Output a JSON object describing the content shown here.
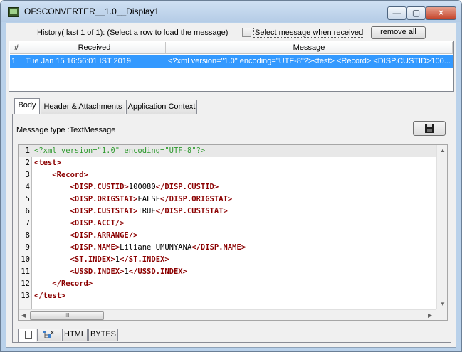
{
  "window": {
    "title": "OFSCONVERTER__1.0__Display1",
    "minimize_glyph": "—",
    "maximize_glyph": "▢",
    "close_glyph": "✕"
  },
  "history": {
    "label": "History( last 1 of 1):   (Select a row to load the message)",
    "checkbox_label": "Select message when received",
    "checkbox_checked": false,
    "remove_all_label": "remove all"
  },
  "table": {
    "columns": [
      "#",
      "Received",
      "Message"
    ],
    "rows": [
      {
        "index": "1",
        "received": "Tue Jan 15 16:56:01 IST 2019",
        "message": "<?xml version=\"1.0\" encoding=\"UTF-8\"?><test>    <Record>       <DISP.CUSTID>100..."
      }
    ]
  },
  "tabs": [
    "Body",
    "Header & Attachments",
    "Application Context"
  ],
  "active_tab": "Body",
  "body": {
    "message_type": "Message type :TextMessage",
    "save_icon": "floppy-disk-icon"
  },
  "editor": {
    "line_numbers": [
      "1",
      "2",
      "3",
      "4",
      "5",
      "6",
      "7",
      "8",
      "9",
      "10",
      "11",
      "12",
      "13"
    ],
    "lines": [
      [
        {
          "t": "<?xml version=\"1.0\" encoding=\"UTF-8\"?>",
          "c": "green"
        }
      ],
      [
        {
          "t": "<test>",
          "c": "tag"
        }
      ],
      [
        {
          "t": "    ",
          "c": "text"
        },
        {
          "t": "<Record>",
          "c": "tag"
        }
      ],
      [
        {
          "t": "        ",
          "c": "text"
        },
        {
          "t": "<DISP.CUSTID>",
          "c": "tag"
        },
        {
          "t": "100080",
          "c": "text"
        },
        {
          "t": "</DISP.CUSTID>",
          "c": "tag"
        }
      ],
      [
        {
          "t": "        ",
          "c": "text"
        },
        {
          "t": "<DISP.ORIGSTAT>",
          "c": "tag"
        },
        {
          "t": "FALSE",
          "c": "text"
        },
        {
          "t": "</DISP.ORIGSTAT>",
          "c": "tag"
        }
      ],
      [
        {
          "t": "        ",
          "c": "text"
        },
        {
          "t": "<DISP.CUSTSTAT>",
          "c": "tag"
        },
        {
          "t": "TRUE",
          "c": "text"
        },
        {
          "t": "</DISP.CUSTSTAT>",
          "c": "tag"
        }
      ],
      [
        {
          "t": "        ",
          "c": "text"
        },
        {
          "t": "<DISP.ACCT/>",
          "c": "tag"
        }
      ],
      [
        {
          "t": "        ",
          "c": "text"
        },
        {
          "t": "<DISP.ARRANGE/>",
          "c": "tag"
        }
      ],
      [
        {
          "t": "        ",
          "c": "text"
        },
        {
          "t": "<DISP.NAME>",
          "c": "tag"
        },
        {
          "t": "Liliane UMUNYANA",
          "c": "text"
        },
        {
          "t": "</DISP.NAME>",
          "c": "tag"
        }
      ],
      [
        {
          "t": "        ",
          "c": "text"
        },
        {
          "t": "<ST.INDEX>",
          "c": "tag"
        },
        {
          "t": "1",
          "c": "text"
        },
        {
          "t": "</ST.INDEX>",
          "c": "tag"
        }
      ],
      [
        {
          "t": "        ",
          "c": "text"
        },
        {
          "t": "<USSD.INDEX>",
          "c": "tag"
        },
        {
          "t": "1",
          "c": "text"
        },
        {
          "t": "</USSD.INDEX>",
          "c": "tag"
        }
      ],
      [
        {
          "t": "    ",
          "c": "text"
        },
        {
          "t": "</Record>",
          "c": "tag"
        }
      ],
      [
        {
          "t": "</test>",
          "c": "tag"
        }
      ]
    ],
    "scroll_up": "▲",
    "scroll_down": "▼",
    "scroll_left": "◀",
    "scroll_right": "▶",
    "thumb_grip": "III"
  },
  "bottom_tabs": [
    "",
    "",
    "HTML",
    "BYTES"
  ],
  "colors": {
    "selection": "#3399ff",
    "xml_decl": "#2f9a2f",
    "xml_tag": "#8b0000",
    "frame": "#b9d1ea"
  }
}
